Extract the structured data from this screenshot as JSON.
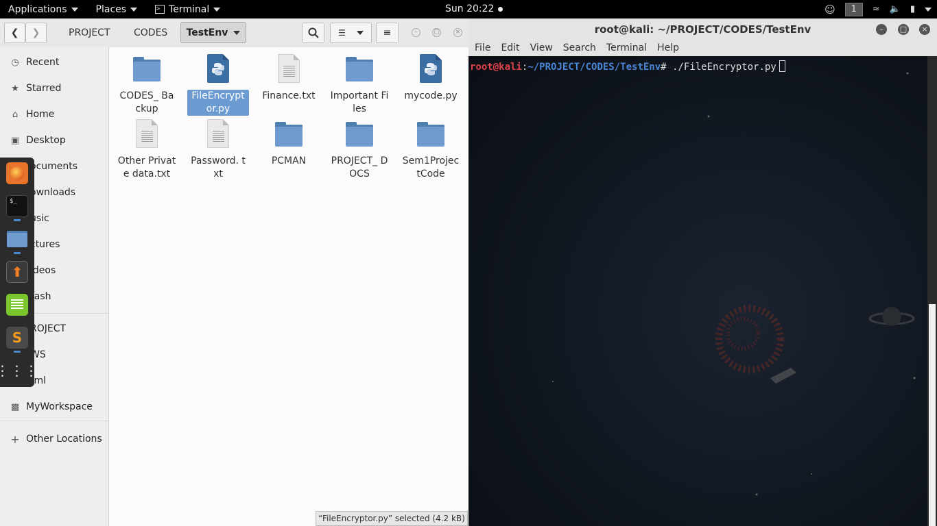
{
  "topbar": {
    "applications": "Applications",
    "places": "Places",
    "terminal": "Terminal",
    "clock": "Sun 20:22",
    "workspace": "1"
  },
  "filemanager": {
    "breadcrumbs": [
      "PROJECT",
      "CODES"
    ],
    "active_crumb": "TestEnv",
    "sidebar": [
      {
        "label": "Recent",
        "icon": "clock-icon"
      },
      {
        "label": "Starred",
        "icon": "star-icon"
      },
      {
        "label": "Home",
        "icon": "home-icon"
      },
      {
        "label": "Desktop",
        "icon": "desktop-icon"
      },
      {
        "label": "ocuments",
        "icon": "folder-icon"
      },
      {
        "label": "ownloads",
        "icon": "folder-icon"
      },
      {
        "label": "usic",
        "icon": "folder-icon"
      },
      {
        "label": "ctures",
        "icon": "folder-icon"
      },
      {
        "label": "ideos",
        "icon": "folder-icon"
      },
      {
        "label": "rash",
        "icon": "trash-icon"
      },
      {
        "label": "ROJECT",
        "icon": "folder-icon"
      },
      {
        "label": "WS",
        "icon": "folder-icon"
      },
      {
        "label": "tml",
        "icon": "folder-icon"
      },
      {
        "label": "MyWorkspace",
        "icon": "folder-icon"
      },
      {
        "label": "Other Locations",
        "icon": "plus-icon"
      }
    ],
    "files": [
      {
        "name": "CODES_ Backup",
        "type": "folder"
      },
      {
        "name": "FileEncrypt or.py",
        "type": "python",
        "selected": true
      },
      {
        "name": "Finance.txt",
        "type": "text"
      },
      {
        "name": "Important Files",
        "type": "folder"
      },
      {
        "name": "mycode.py",
        "type": "python"
      },
      {
        "name": "Other Private data.txt",
        "type": "text"
      },
      {
        "name": "Password. txt",
        "type": "text"
      },
      {
        "name": "PCMAN",
        "type": "folder"
      },
      {
        "name": "PROJECT_ DOCS",
        "type": "folder"
      },
      {
        "name": "Sem1Projec tCode",
        "type": "folder"
      }
    ],
    "status": "“FileEncryptor.py” selected  (4.2 kB)"
  },
  "terminal": {
    "title": "root@kali: ~/PROJECT/CODES/TestEnv",
    "menu": [
      "File",
      "Edit",
      "View",
      "Search",
      "Terminal",
      "Help"
    ],
    "prompt_user": "root@kali",
    "prompt_sep": ":",
    "prompt_path": "~/PROJECT/CODES/TestEnv",
    "prompt_end": "# ",
    "command": "./FileEncryptor.py"
  },
  "colors": {
    "prompt_user": "#e0434a",
    "prompt_path": "#4a86d8",
    "selection": "#6b9bd1"
  }
}
